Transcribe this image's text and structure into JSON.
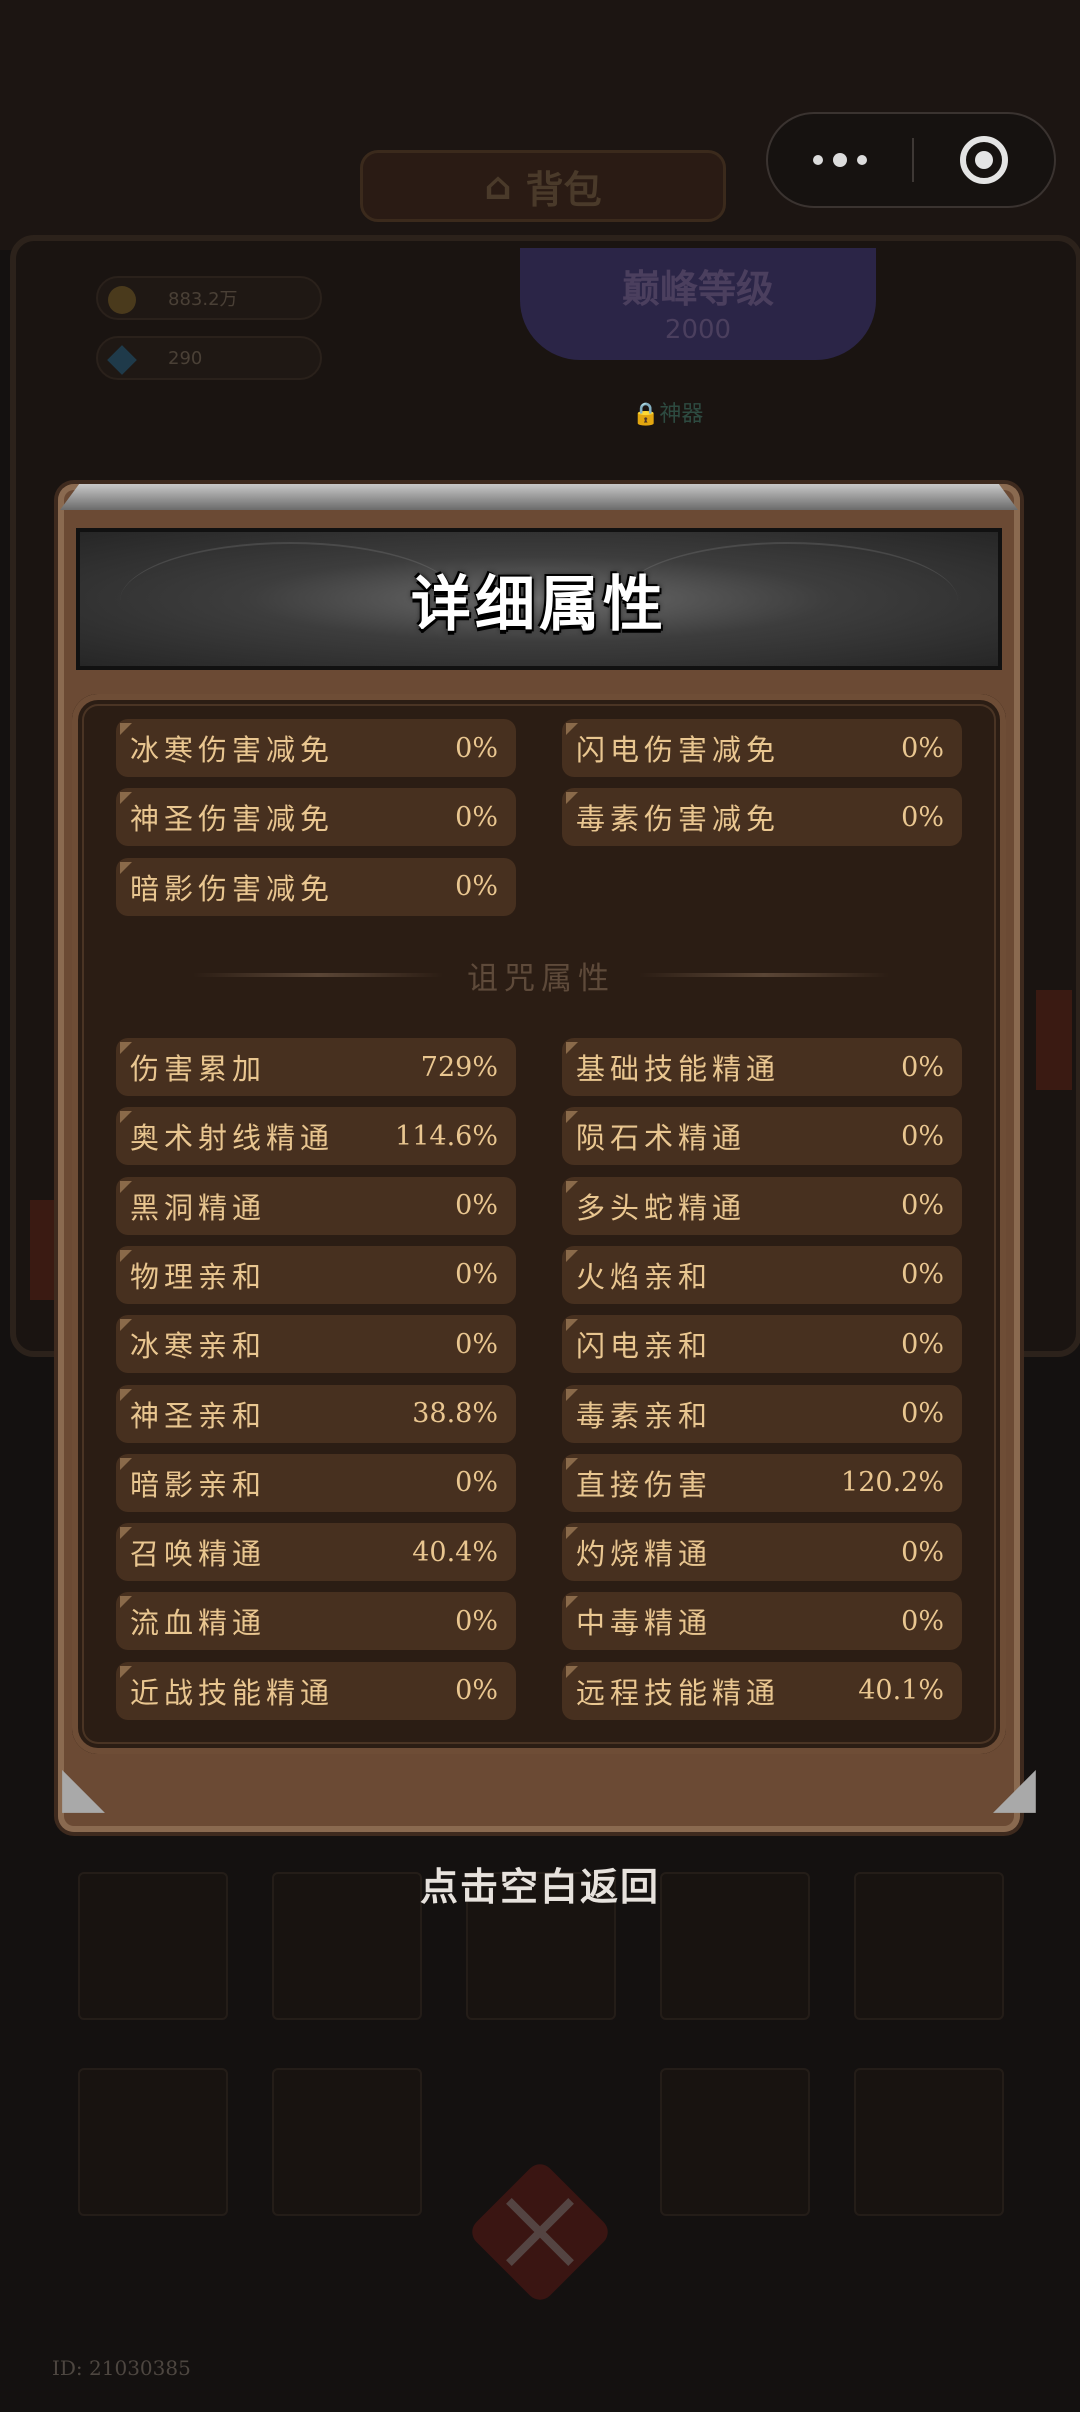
{
  "background": {
    "screen_title": "背包",
    "currency": {
      "gold": "883.2万",
      "gems": "290"
    },
    "peak_level": {
      "label": "巅峰等级",
      "value": "2000"
    },
    "lock_label": "神器",
    "uid": "ID: 21030385"
  },
  "capsule": {
    "more_icon": "more-dots-icon",
    "close_icon": "target-close-icon"
  },
  "panel": {
    "title": "详细属性",
    "reduction_rows": [
      {
        "label": "冰寒伤害减免",
        "value": "0%"
      },
      {
        "label": "闪电伤害减免",
        "value": "0%"
      },
      {
        "label": "神圣伤害减免",
        "value": "0%"
      },
      {
        "label": "毒素伤害减免",
        "value": "0%"
      },
      {
        "label": "暗影伤害减免",
        "value": "0%"
      }
    ],
    "section_title": "诅咒属性",
    "curse_rows": [
      {
        "label": "伤害累加",
        "value": "729%"
      },
      {
        "label": "基础技能精通",
        "value": "0%"
      },
      {
        "label": "奥术射线精通",
        "value": "114.6%"
      },
      {
        "label": "陨石术精通",
        "value": "0%"
      },
      {
        "label": "黑洞精通",
        "value": "0%"
      },
      {
        "label": "多头蛇精通",
        "value": "0%"
      },
      {
        "label": "物理亲和",
        "value": "0%"
      },
      {
        "label": "火焰亲和",
        "value": "0%"
      },
      {
        "label": "冰寒亲和",
        "value": "0%"
      },
      {
        "label": "闪电亲和",
        "value": "0%"
      },
      {
        "label": "神圣亲和",
        "value": "38.8%"
      },
      {
        "label": "毒素亲和",
        "value": "0%"
      },
      {
        "label": "暗影亲和",
        "value": "0%"
      },
      {
        "label": "直接伤害",
        "value": "120.2%"
      },
      {
        "label": "召唤精通",
        "value": "40.4%"
      },
      {
        "label": "灼烧精通",
        "value": "0%"
      },
      {
        "label": "流血精通",
        "value": "0%"
      },
      {
        "label": "中毒精通",
        "value": "0%"
      },
      {
        "label": "近战技能精通",
        "value": "0%"
      },
      {
        "label": "远程技能精通",
        "value": "40.1%"
      }
    ]
  },
  "hint": "点击空白返回"
}
